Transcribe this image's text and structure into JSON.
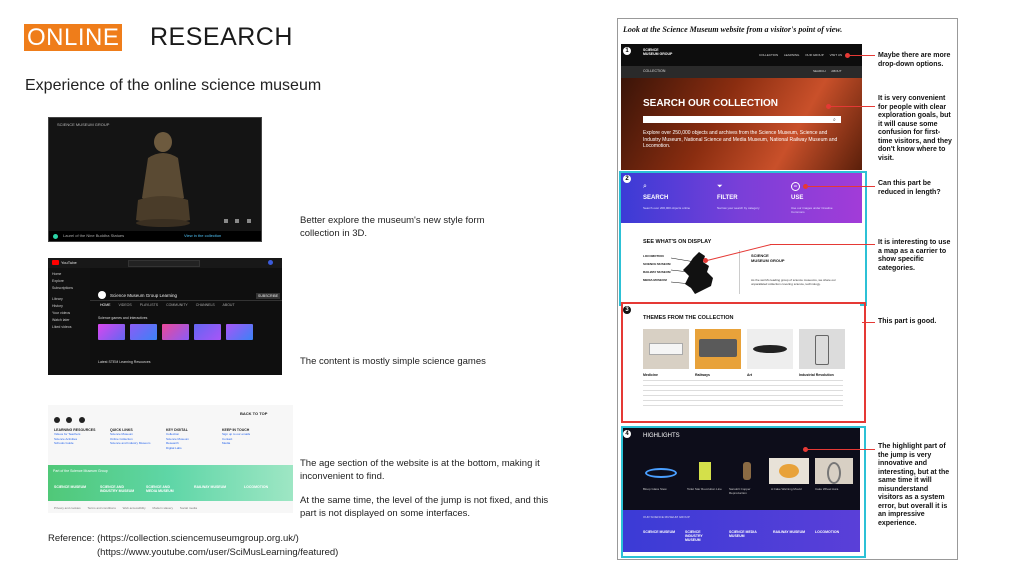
{
  "header": {
    "online": "ONLINE",
    "research": "RESEARCH"
  },
  "subtitle": "Experience of the online science museum",
  "thumb1": {
    "brand": "SCIENCE MUSEUM GROUP",
    "footer_text": "Laurel of the Nine Buddha Statues",
    "cta": "View in the collection"
  },
  "thumb2": {
    "logo": "YouTube",
    "channel": "Science Museum Group Learning",
    "tabs": [
      "HOME",
      "VIDEOS",
      "PLAYLISTS",
      "COMMUNITY",
      "CHANNELS",
      "ABOUT"
    ],
    "subscribe": "SUBSCRIBE",
    "sidebar": [
      "Home",
      "Explore",
      "Subscriptions",
      "Library",
      "History",
      "Your videos",
      "Watch later",
      "Liked videos"
    ],
    "section_title": "Science games and interactives",
    "bottom_caption": "Latest STEM Learning Resources"
  },
  "thumb3": {
    "back_to_top": "BACK TO TOP",
    "columns": [
      {
        "title": "LEARNING RESOURCES",
        "items": [
          "Videos for Teachers",
          "Science Activities",
          "Schools Guide"
        ]
      },
      {
        "title": "QUICK LINKS",
        "items": [
          "Science Museum",
          "Online Collection",
          "Science and Industry Museum"
        ]
      },
      {
        "title": "KEY DIGITAL",
        "items": [
          "Collection",
          "Science Museum",
          "Research",
          "Digital Labs"
        ]
      },
      {
        "title": "KEEP IN TOUCH",
        "items": [
          "Sign up to our emails",
          "Contact",
          "Media"
        ]
      }
    ],
    "green_heading": "Part of the Science Museum Group",
    "logos": [
      "SCIENCE MUSEUM",
      "SCIENCE AND INDUSTRY MUSEUM",
      "SCIENCE AND MEDIA MUSEUM",
      "RAILWAY MUSEUM",
      "LOCOMOTION"
    ],
    "bottom_links": [
      "Privacy and cookies",
      "Terms and conditions",
      "Web accessibility",
      "Modern slavery",
      "Social media"
    ]
  },
  "captions": {
    "c1": "Better explore the museum's new style form collection in 3D.",
    "c2": "The content is mostly simple science games",
    "c3a": "The age section of the website is at the bottom, making it inconvenient to find.",
    "c3b": "At the same time, the level of the jump is not fixed, and this part is not displayed on some interfaces."
  },
  "reference": {
    "line1": "Reference: (https://collection.sciencemuseumgroup.org.uk/)",
    "line2": "(https://www.youtube.com/user/SciMusLearning/featured)"
  },
  "right_panel": {
    "title": "Look at the Science Museum website from a visitor's point of view.",
    "s1": {
      "num": "1",
      "brand": "SCIENCE MUSEUM GROUP",
      "nav": [
        "COLLECTION",
        "LEARNING",
        "OUR GROUP",
        "VISIT US"
      ],
      "subnav": "COLLECTION",
      "subnav_links": [
        "SEARCH",
        "ABOUT"
      ],
      "hero_title": "SEARCH OUR COLLECTION",
      "hero_text": "Explore over 250,000 objects and archives from the Science Museum, Science and Industry Museum, National Science and Media Museum, National Railway Museum and Locomotion."
    },
    "s2": {
      "num": "2",
      "items": [
        {
          "label": "SEARCH",
          "desc": "Search over 200,000 objects online",
          "icon": "magnifier-icon"
        },
        {
          "label": "FILTER",
          "desc": "Narrow your search by category",
          "icon": "filter-icon"
        },
        {
          "label": "USE",
          "desc": "Use our images under Creative Commons",
          "icon": "cc-icon"
        }
      ],
      "display_title": "SEE WHAT'S ON DISPLAY",
      "map_list": [
        "LOCOMOTION",
        "SCIENCE MUSEUM",
        "RAILWAY MUSEUM",
        "MEDIA MUSEUM"
      ],
      "brand": "SCIENCE MUSEUM GROUP",
      "text": "As the world's leading group of science museums, we share our unparalleled collection covering science, technology."
    },
    "s3": {
      "num": "3",
      "title": "THEMES FROM THE COLLECTION",
      "themes": [
        "Medicine",
        "Railways",
        "Art",
        "Industrial Revolution"
      ]
    },
    "s4": {
      "num": "4",
      "title": "HIGHLIGHTS",
      "items": [
        "Bloop Glass Stew",
        "Toilet Star Revolution Line",
        "Sanskrit Copper Reproduction",
        "A Cake Warning Mould",
        "Cake Wheel Aura"
      ],
      "footer_heading": "OUR SCIENCE MUSEUM GROUP",
      "logos": [
        "SCIENCE MUSEUM",
        "SCIENCE INDUSTRY MUSEUM",
        "SCIENCE MEDIA MUSEUM",
        "RAILWAY MUSEUM",
        "LOCOMOTION"
      ]
    },
    "notes": {
      "n1": "Maybe there are more drop-down options.",
      "n2": "It is very convenient for people with clear exploration goals, but it will cause some confusion for first-time visitors, and they don't know where to visit.",
      "n3": "Can this part be reduced in length?",
      "n4": "It is interesting to use a map as a carrier to show specific categories.",
      "n5": "This part is good.",
      "n6": "The highlight part of the jump is very innovative and interesting, but at the same time it will misunderstand visitors as a system error, but overall it is an impressive experience."
    }
  },
  "colors": {
    "orange": "#ef7d1a",
    "red": "#e53935",
    "cyan": "#2cc1d6",
    "purple_start": "#3b3bd6",
    "purple_end": "#a23cd8",
    "green": "#5fd6a7"
  }
}
